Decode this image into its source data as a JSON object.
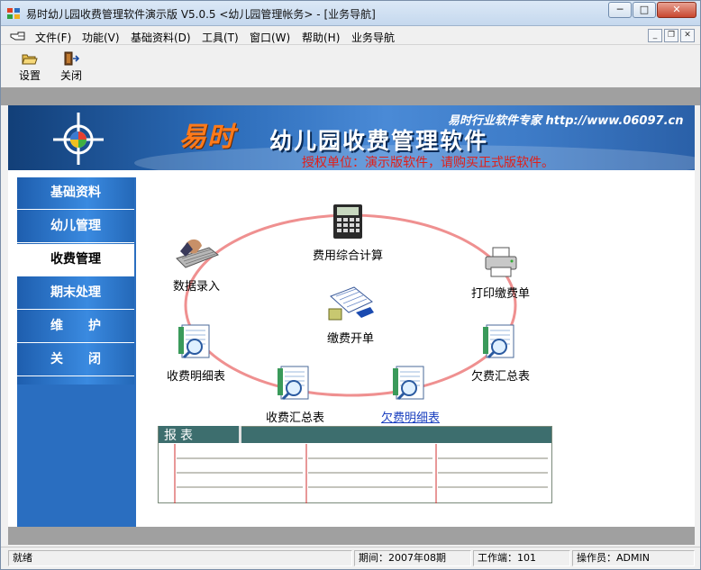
{
  "window": {
    "title": "易时幼儿园收费管理软件演示版 V5.0.5 <幼儿园管理帐务> - [业务导航]",
    "min_label": "─",
    "max_label": "□",
    "close_label": "✕"
  },
  "menu": {
    "items": [
      "文件(F)",
      "功能(V)",
      "基础资料(D)",
      "工具(T)",
      "窗口(W)",
      "帮助(H)",
      "业务导航"
    ],
    "mdi_min": "_",
    "mdi_restore": "❐",
    "mdi_close": "✕"
  },
  "toolbar": {
    "settings_label": "设置",
    "close_label": "关闭"
  },
  "banner": {
    "brand": "易时",
    "product": "幼儿园收费管理软件",
    "expert": "易时行业软件专家 http://www.06097.cn",
    "license": "授权单位：演示版软件，请购买正式版软件。"
  },
  "sidebar": {
    "items": [
      {
        "label": "基础资料",
        "active": false
      },
      {
        "label": "幼儿管理",
        "active": false
      },
      {
        "label": "收费管理",
        "active": true
      },
      {
        "label": "期末处理",
        "active": false
      },
      {
        "label": "维　　护",
        "active": false
      },
      {
        "label": "关　　闭",
        "active": false
      }
    ]
  },
  "diagram": {
    "nodes": {
      "fee_calc": "费用综合计算",
      "data_entry": "数据录入",
      "print_receipt": "打印缴费单",
      "payment_order": "缴费开单",
      "fee_detail": "收费明细表",
      "arrears_summary": "欠费汇总表",
      "fee_summary": "收费汇总表",
      "arrears_detail": "欠费明细表"
    }
  },
  "report": {
    "title": "报表"
  },
  "status": {
    "ready": "就绪",
    "period": "期间：2007年08期",
    "terminal": "工作端：101",
    "operator": "操作员：ADMIN"
  },
  "colors": {
    "banner_blue": "#2b6bb8",
    "sidebar_blue": "#2a6ec0",
    "cycle_pink": "#ef9090",
    "report_header": "#3d6e6e",
    "license_red": "#e0201a"
  }
}
